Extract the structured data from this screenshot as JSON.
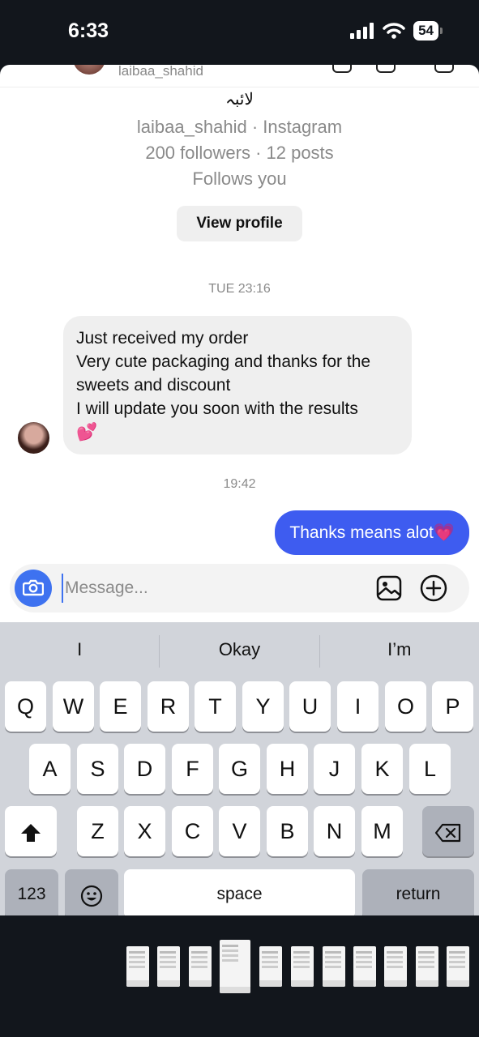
{
  "status_bar": {
    "time": "6:33",
    "battery": "54"
  },
  "header": {
    "username": "laibaa_shahid"
  },
  "profile": {
    "display_name": "لائبہ",
    "handle_line": "laibaa_shahid · Instagram",
    "stats_line": "200 followers · 12 posts",
    "follow_status": "Follows you",
    "view_profile_label": "View profile"
  },
  "thread": {
    "timestamp_1": "TUE 23:16",
    "incoming_lines": [
      "Just received my order",
      "Very cute packaging and thanks for the sweets and discount",
      "I will update you soon with the results",
      "💕"
    ],
    "timestamp_2": "19:42",
    "outgoing_text": "Thanks means alot",
    "outgoing_emoji": "💗"
  },
  "composer": {
    "placeholder": "Message..."
  },
  "keyboard": {
    "suggestions": [
      "I",
      "Okay",
      "I’m"
    ],
    "row1": [
      "Q",
      "W",
      "E",
      "R",
      "T",
      "Y",
      "U",
      "I",
      "O",
      "P"
    ],
    "row2": [
      "A",
      "S",
      "D",
      "F",
      "G",
      "H",
      "J",
      "K",
      "L"
    ],
    "row3": [
      "Z",
      "X",
      "C",
      "V",
      "B",
      "N",
      "M"
    ],
    "numbers_label": "123",
    "space_label": "space",
    "return_label": "return"
  }
}
